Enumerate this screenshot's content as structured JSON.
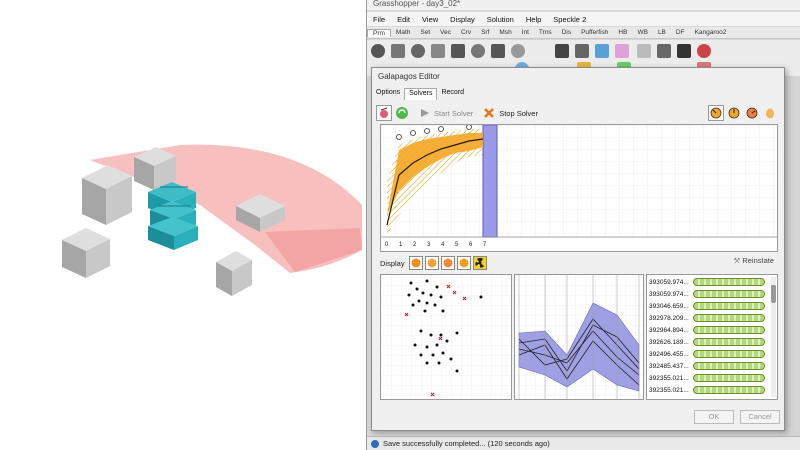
{
  "app": {
    "title": "Grasshopper - day3_02*"
  },
  "menu": [
    "File",
    "Edit",
    "View",
    "Display",
    "Solution",
    "Help",
    "Speckle 2"
  ],
  "tabs": [
    {
      "label": "Prm",
      "active": true
    },
    {
      "label": "Math"
    },
    {
      "label": "Set"
    },
    {
      "label": "Vec"
    },
    {
      "label": "Crv"
    },
    {
      "label": "Srf"
    },
    {
      "label": "Msh"
    },
    {
      "label": "Int"
    },
    {
      "label": "Trns"
    },
    {
      "label": "Dis"
    },
    {
      "label": "Pufferfish"
    },
    {
      "label": "HB"
    },
    {
      "label": "WB"
    },
    {
      "label": "LB"
    },
    {
      "label": "DF"
    },
    {
      "label": "Kangaroo2"
    }
  ],
  "galapagos": {
    "title": "Galapagos Editor",
    "tabs": [
      {
        "label": "Options"
      },
      {
        "label": "Solvers",
        "active": true
      },
      {
        "label": "Record"
      }
    ],
    "start_label": "Start Solver",
    "stop_label": "Stop Solver",
    "display_label": "Display",
    "reinstate_label": "Reinstate",
    "ok_label": "OK",
    "cancel_label": "Cancel",
    "generation_ticks": [
      "0",
      "1",
      "2",
      "3",
      "4",
      "5",
      "6",
      "7"
    ],
    "genomes": [
      "393059.974...",
      "393059.974...",
      "393046.659...",
      "392978.209...",
      "392964.894...",
      "392626.189...",
      "392496.455...",
      "392485.437...",
      "392355.021...",
      "392355.021..."
    ]
  },
  "status": {
    "text": "Save successfully completed... (120 seconds ago)"
  },
  "colors": {
    "accent_orange": "#f5a623",
    "selection_blue": "#8f8fe0",
    "fitness_green": "#b4d97a"
  }
}
